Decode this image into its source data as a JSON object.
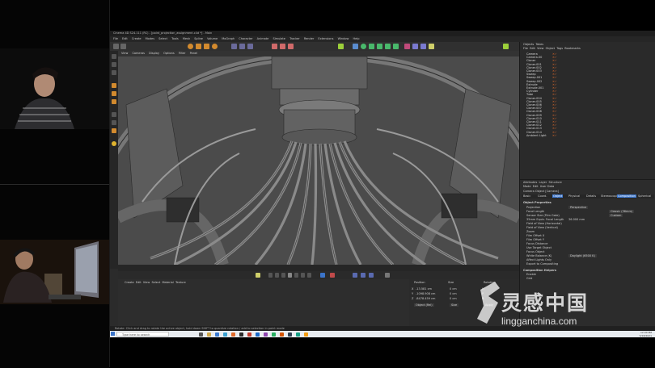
{
  "app": {
    "title": "Cinema 4D S24.111 (RC) - [point_projection_assignment.c4d *] - Main",
    "menus": [
      "File",
      "Edit",
      "Create",
      "Modes",
      "Select",
      "Tools",
      "Mesh",
      "Spline",
      "Volume",
      "MoGraph",
      "Character",
      "Animate",
      "Simulate",
      "Tracker",
      "Render",
      "Extensions",
      "Window",
      "Help"
    ]
  },
  "viewport": {
    "menus": [
      "View",
      "Cameras",
      "Display",
      "Options",
      "Filter",
      "Panel"
    ],
    "label": "Perspective"
  },
  "objects": {
    "tabs": [
      "Objects",
      "Takes"
    ],
    "menus": [
      "File",
      "Edit",
      "View",
      "Object",
      "Tags",
      "Bookmarks"
    ],
    "items": [
      "Camera",
      "Camera.00",
      "Cloner",
      "Cloner.001",
      "Cloner.002",
      "Cloner.003",
      "Sweep",
      "Sweep.001",
      "Sweep.002",
      "Extrude",
      "Extrude.001",
      "Cylinder",
      "Tube",
      "Cloner.004",
      "Cloner.005",
      "Cloner.006",
      "Cloner.007",
      "Cloner.008",
      "Cloner.009",
      "Cloner.010",
      "Cloner.011",
      "Cloner.012",
      "Cloner.013",
      "Cloner.014",
      "Ambient Light"
    ]
  },
  "attributes": {
    "tabs": [
      "Attributes",
      "Layer",
      "Structure"
    ],
    "menus": [
      "Mode",
      "Edit",
      "User Data"
    ],
    "object_label": "Camera Object [Camera]",
    "subtabs": [
      "Basic",
      "Coord.",
      "Object",
      "Physical",
      "Details",
      "Stereoscopic",
      "Composition",
      "Spherical"
    ],
    "section": "Object Properties",
    "fields": [
      {
        "label": "Projection",
        "value": "Perspective"
      },
      {
        "label": "Focal Length",
        "value": "Classic (36mm)"
      },
      {
        "label": "Sensor Size (Film Gate)",
        "value": "Custom"
      },
      {
        "label": "35mm Equiv. Focal Length",
        "value": "36.000 mm"
      },
      {
        "label": "Field of View (Horizontal)",
        "value": ""
      },
      {
        "label": "Field of View (Vertical)",
        "value": ""
      },
      {
        "label": "Zoom",
        "value": ""
      },
      {
        "label": "Film Offset X",
        "value": ""
      },
      {
        "label": "Film Offset Y",
        "value": ""
      },
      {
        "label": "Focus Distance",
        "value": ""
      },
      {
        "label": "Use Target Object",
        "value": ""
      },
      {
        "label": "Focus Object",
        "value": ""
      },
      {
        "label": "White Balance (K)",
        "value": "Daylight (6500 K)"
      },
      {
        "label": "Affect Lights Only",
        "value": ""
      },
      {
        "label": "Export to Compositing",
        "value": ""
      }
    ],
    "section2": "Composition Helpers",
    "fields2": [
      "Enable",
      "Grid"
    ]
  },
  "material_manager": {
    "menus": [
      "Create",
      "Edit",
      "View",
      "Select",
      "Material",
      "Texture"
    ]
  },
  "coordinates": {
    "headers": [
      "Position",
      "Size",
      "Rotation"
    ],
    "rows": [
      {
        "axis": "X",
        "pos": "-13.581 cm",
        "size": "0 cm",
        "rot": "H"
      },
      {
        "axis": "Y",
        "pos": "-1098.908 cm",
        "size": "0 cm",
        "rot": "P"
      },
      {
        "axis": "Z",
        "pos": "-8478.459 cm",
        "size": "0 cm",
        "rot": "B"
      }
    ],
    "mode": "Object (Rel)",
    "size_mode": "Size",
    "apply": "Apply"
  },
  "status": "Rotate: Click and drag to rotate the active object; hold down SHIFT to quantize rotation / add to selection in point mode",
  "taskbar": {
    "search": "Type here to search",
    "time": "12:00 PM",
    "date": "5/18/2021"
  },
  "watermark": {
    "text": "灵感中国",
    "url": "lingganchina.com"
  },
  "colors": {
    "accent": "#e06a2a",
    "blue_ui": "#3b74c9",
    "viewport_bg": "#4a4a4a"
  }
}
